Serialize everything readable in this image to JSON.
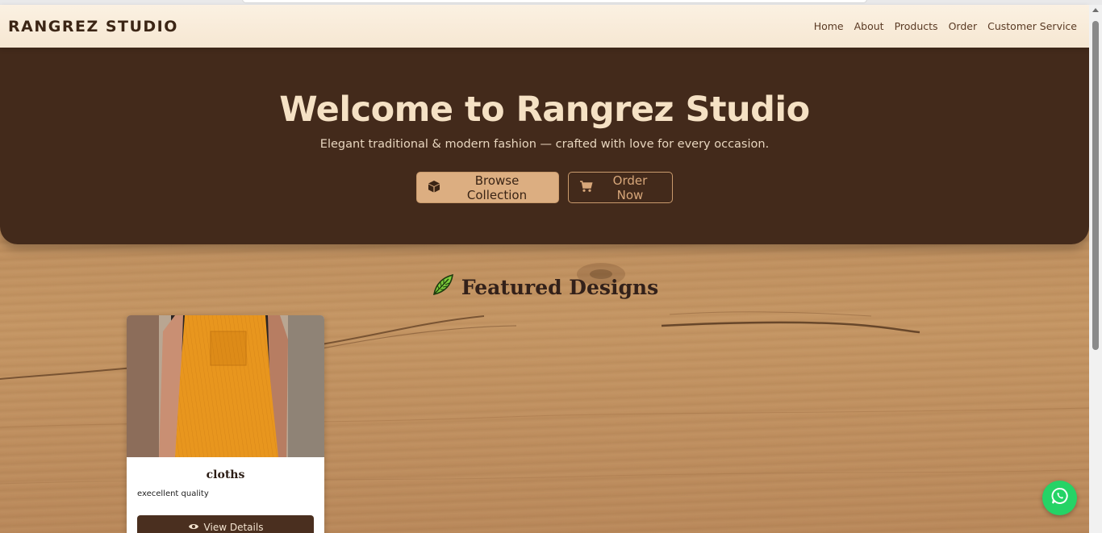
{
  "nav": {
    "brand": "RANGREZ STUDIO",
    "links": [
      "Home",
      "About",
      "Products",
      "Order",
      "Customer Service"
    ]
  },
  "hero": {
    "title": "Welcome to Rangrez Studio",
    "subtitle": "Elegant traditional & modern fashion — crafted with love for every occasion.",
    "primary_button": {
      "label": "Browse Collection",
      "icon": "box-icon"
    },
    "secondary_button": {
      "label": "Order Now",
      "icon": "cart-icon"
    }
  },
  "featured": {
    "title": "Featured Designs",
    "icon": "leaf-icon",
    "products": [
      {
        "name": "cloths",
        "description": "execellent quality",
        "button_label": "View Details",
        "button_icon": "eye-icon"
      }
    ]
  },
  "floating": {
    "icon": "whatsapp-icon"
  },
  "colors": {
    "hero_bg": "#432a1b",
    "nav_bg": "#fbf1e2",
    "accent": "#dcae81",
    "whatsapp": "#25d366"
  }
}
